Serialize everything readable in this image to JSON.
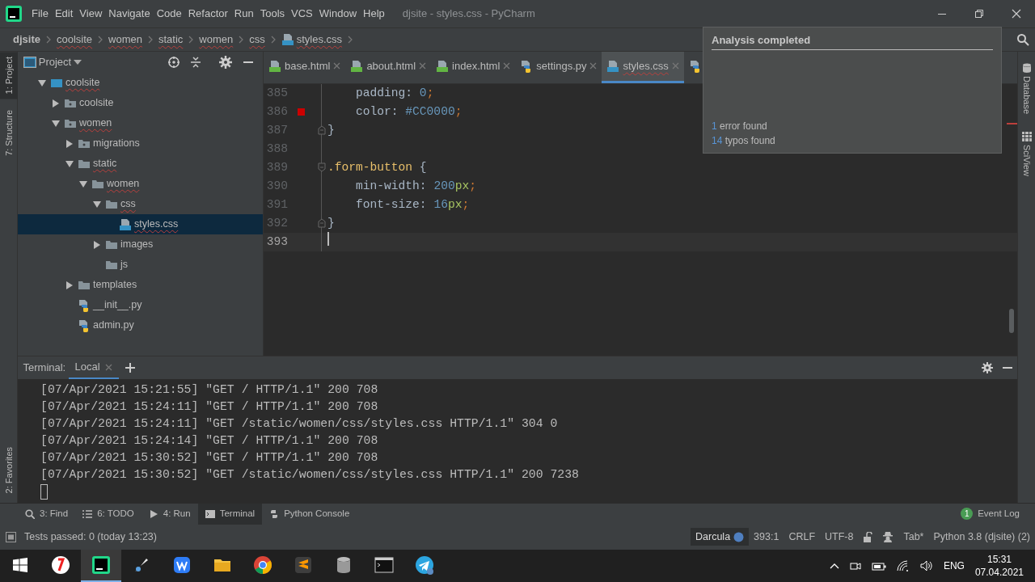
{
  "window": {
    "title": "djsite - styles.css - PyCharm"
  },
  "menu": [
    "File",
    "Edit",
    "View",
    "Navigate",
    "Code",
    "Refactor",
    "Run",
    "Tools",
    "VCS",
    "Window",
    "Help"
  ],
  "breadcrumb": [
    {
      "label": "djsite",
      "kind": "project",
      "typo": false
    },
    {
      "label": "coolsite",
      "kind": "folder",
      "typo": true
    },
    {
      "label": "women",
      "kind": "folder",
      "typo": true
    },
    {
      "label": "static",
      "kind": "folder",
      "typo": true
    },
    {
      "label": "women",
      "kind": "folder",
      "typo": true
    },
    {
      "label": "css",
      "kind": "folder",
      "typo": true
    },
    {
      "label": "styles.css",
      "kind": "file",
      "typo": true
    }
  ],
  "left_tool_tabs": [
    {
      "label": "1: Project",
      "selected": true
    },
    {
      "label": "7: Structure",
      "selected": false
    }
  ],
  "favorites_tab": {
    "label": "2: Favorites"
  },
  "right_tool_tabs": [
    {
      "label": "Database",
      "kind": "database"
    },
    {
      "label": "SciView",
      "kind": "sciview"
    }
  ],
  "project_panel": {
    "title": "Project",
    "tree": [
      {
        "label": "coolsite",
        "kind": "module",
        "expanded": true,
        "typo": true,
        "selected": false,
        "children": [
          {
            "label": "coolsite",
            "kind": "package",
            "expanded": false,
            "typo": false,
            "selected": false
          },
          {
            "label": "women",
            "kind": "package",
            "expanded": true,
            "typo": true,
            "selected": false,
            "children": [
              {
                "label": "migrations",
                "kind": "package",
                "expanded": false,
                "typo": false,
                "selected": false
              },
              {
                "label": "static",
                "kind": "folder",
                "expanded": true,
                "typo": true,
                "selected": false,
                "children": [
                  {
                    "label": "women",
                    "kind": "folder",
                    "expanded": true,
                    "typo": true,
                    "selected": false,
                    "children": [
                      {
                        "label": "css",
                        "kind": "folder",
                        "expanded": true,
                        "typo": true,
                        "selected": false,
                        "children": [
                          {
                            "label": "styles.css",
                            "kind": "css",
                            "typo": true,
                            "selected": true
                          }
                        ]
                      },
                      {
                        "label": "images",
                        "kind": "folder",
                        "expanded": false,
                        "typo": false,
                        "selected": false
                      },
                      {
                        "label": "js",
                        "kind": "folder",
                        "typo": false,
                        "selected": false
                      }
                    ]
                  }
                ]
              },
              {
                "label": "templates",
                "kind": "folder",
                "expanded": false,
                "typo": false,
                "selected": false
              },
              {
                "label": "__init__.py",
                "kind": "py",
                "typo": false,
                "selected": false
              },
              {
                "label": "admin.py",
                "kind": "py",
                "typo": false,
                "selected": false
              }
            ]
          }
        ]
      }
    ]
  },
  "editor_tabs": [
    {
      "label": "base.html",
      "kind": "html",
      "selected": false,
      "typo": false
    },
    {
      "label": "about.html",
      "kind": "html",
      "selected": false,
      "typo": false
    },
    {
      "label": "index.html",
      "kind": "html",
      "selected": false,
      "typo": false
    },
    {
      "label": "settings.py",
      "kind": "py",
      "selected": false,
      "typo": false
    },
    {
      "label": "styles.css",
      "kind": "css",
      "selected": true,
      "typo": true
    },
    {
      "kind": "py",
      "selected": false
    }
  ],
  "code_lines": [
    {
      "number": "385",
      "kind": "plain",
      "current": false,
      "tokens": [
        {
          "kind": "plain",
          "text": "    padding: "
        },
        {
          "kind": "number",
          "text": "0"
        },
        {
          "kind": "semicolon",
          "text": ";"
        }
      ]
    },
    {
      "number": "386",
      "kind": "plain",
      "current": false,
      "color": "#cc0000",
      "tokens": [
        {
          "kind": "plain",
          "text": "    color: "
        },
        {
          "kind": "number",
          "text": "#CC0000"
        },
        {
          "kind": "semicolon",
          "text": ";"
        }
      ]
    },
    {
      "number": "387",
      "kind": "fold_end",
      "current": false,
      "tokens": [
        {
          "kind": "plain",
          "text": "}"
        }
      ]
    },
    {
      "number": "388",
      "kind": "plain",
      "current": false
    },
    {
      "number": "389",
      "kind": "fold_start",
      "current": false,
      "tokens": [
        {
          "kind": "selector",
          "text": ".form-button"
        },
        {
          "kind": "plain",
          "text": " {"
        }
      ]
    },
    {
      "number": "390",
      "kind": "plain",
      "current": false,
      "tokens": [
        {
          "kind": "plain",
          "text": "    min-width: "
        },
        {
          "kind": "number",
          "text": "200"
        },
        {
          "kind": "unit",
          "text": "px"
        },
        {
          "kind": "semicolon",
          "text": ";"
        }
      ]
    },
    {
      "number": "391",
      "kind": "plain",
      "current": false,
      "tokens": [
        {
          "kind": "plain",
          "text": "    font-size: "
        },
        {
          "kind": "number",
          "text": "16"
        },
        {
          "kind": "unit",
          "text": "px"
        },
        {
          "kind": "semicolon",
          "text": ";"
        }
      ]
    },
    {
      "number": "392",
      "kind": "fold_end",
      "current": false,
      "tokens": [
        {
          "kind": "plain",
          "text": "}"
        }
      ]
    },
    {
      "number": "393",
      "kind": "plain",
      "current": true
    }
  ],
  "analysis_popup": {
    "title": "Analysis completed",
    "results": [
      {
        "count": "1",
        "text": "error found"
      },
      {
        "count": "14",
        "text": "typos found"
      }
    ]
  },
  "terminal": {
    "label": "Terminal:",
    "tabs": [
      {
        "label": "Local",
        "selected": true
      }
    ],
    "lines": [
      "[07/Apr/2021 15:21:55] \"GET / HTTP/1.1\" 200 708",
      "[07/Apr/2021 15:24:11] \"GET / HTTP/1.1\" 200 708",
      "[07/Apr/2021 15:24:11] \"GET /static/women/css/styles.css HTTP/1.1\" 304 0",
      "[07/Apr/2021 15:24:14] \"GET / HTTP/1.1\" 200 708",
      "[07/Apr/2021 15:30:52] \"GET / HTTP/1.1\" 200 708",
      "[07/Apr/2021 15:30:52] \"GET /static/women/css/styles.css HTTP/1.1\" 200 7238"
    ]
  },
  "tool_windows": [
    {
      "label": "3: Find",
      "kind": "search",
      "selected": false
    },
    {
      "label": "6: TODO",
      "kind": "list",
      "selected": false
    },
    {
      "label": "4: Run",
      "kind": "play",
      "selected": false
    },
    {
      "label": "Terminal",
      "kind": "terminal",
      "selected": true
    },
    {
      "label": "Python Console",
      "kind": "python",
      "selected": false
    }
  ],
  "event_log": {
    "label": "Event Log",
    "badge": "1"
  },
  "status_bar": {
    "tests": "Tests passed: 0 (today 13:23)",
    "theme": "Darcula",
    "position": "393:1",
    "line_separator": "CRLF",
    "encoding": "UTF-8",
    "indent": "Tab*",
    "interpreter": "Python 3.8 (djsite) (2)"
  },
  "taskbar": {
    "apps": [
      {
        "kind": "yandex",
        "selected": false
      },
      {
        "kind": "pycharm",
        "selected": true
      },
      {
        "kind": "brush",
        "selected": false
      },
      {
        "kind": "wps",
        "selected": false
      },
      {
        "kind": "explorer",
        "selected": false
      },
      {
        "kind": "chrome",
        "selected": false
      },
      {
        "kind": "sublime",
        "selected": false
      },
      {
        "kind": "database",
        "selected": false
      },
      {
        "kind": "console",
        "selected": false
      },
      {
        "kind": "telegram",
        "selected": false
      }
    ],
    "language": "ENG",
    "time": "15:31",
    "date": "07.04.2021"
  }
}
